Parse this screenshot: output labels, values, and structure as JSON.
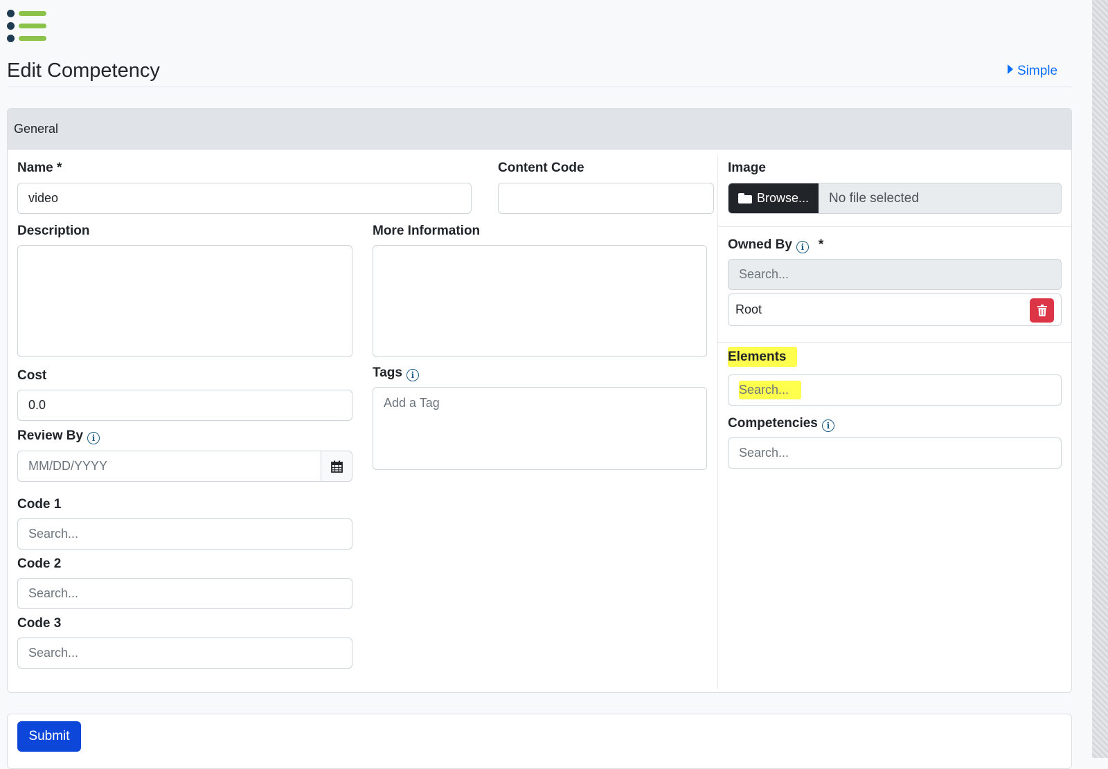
{
  "header": {
    "title": "Edit Competency",
    "simple_link": "Simple"
  },
  "card": {
    "header": "General"
  },
  "form": {
    "name": {
      "label": "Name *",
      "value": "video"
    },
    "content_code": {
      "label": "Content Code",
      "value": ""
    },
    "description": {
      "label": "Description",
      "value": ""
    },
    "more_information": {
      "label": "More Information",
      "value": ""
    },
    "cost": {
      "label": "Cost",
      "value": "0.0"
    },
    "tags": {
      "label": "Tags",
      "placeholder": "Add a Tag"
    },
    "review_by": {
      "label": "Review By",
      "placeholder": "MM/DD/YYYY"
    },
    "code1": {
      "label": "Code 1",
      "placeholder": "Search..."
    },
    "code2": {
      "label": "Code 2",
      "placeholder": "Search..."
    },
    "code3": {
      "label": "Code 3",
      "placeholder": "Search..."
    },
    "image": {
      "label": "Image",
      "browse_label": "Browse...",
      "file_status": "No file selected"
    },
    "owned_by": {
      "label": "Owned By",
      "required_mark": "*",
      "placeholder": "Search...",
      "selected": "Root"
    },
    "elements": {
      "label": "Elements",
      "placeholder": "Search..."
    },
    "competencies": {
      "label": "Competencies",
      "placeholder": "Search..."
    }
  },
  "actions": {
    "submit_label": "Submit"
  },
  "colors": {
    "primary": "#0d47d9",
    "link": "#0d6efd",
    "danger": "#dc3545",
    "highlight": "#ffff4d",
    "logo_green": "#8bc34a",
    "logo_navy": "#1f3b52"
  },
  "icons": [
    "menu-logo-icon",
    "caret-right-icon",
    "info-icon",
    "calendar-icon",
    "folder-open-icon",
    "trash-icon"
  ]
}
